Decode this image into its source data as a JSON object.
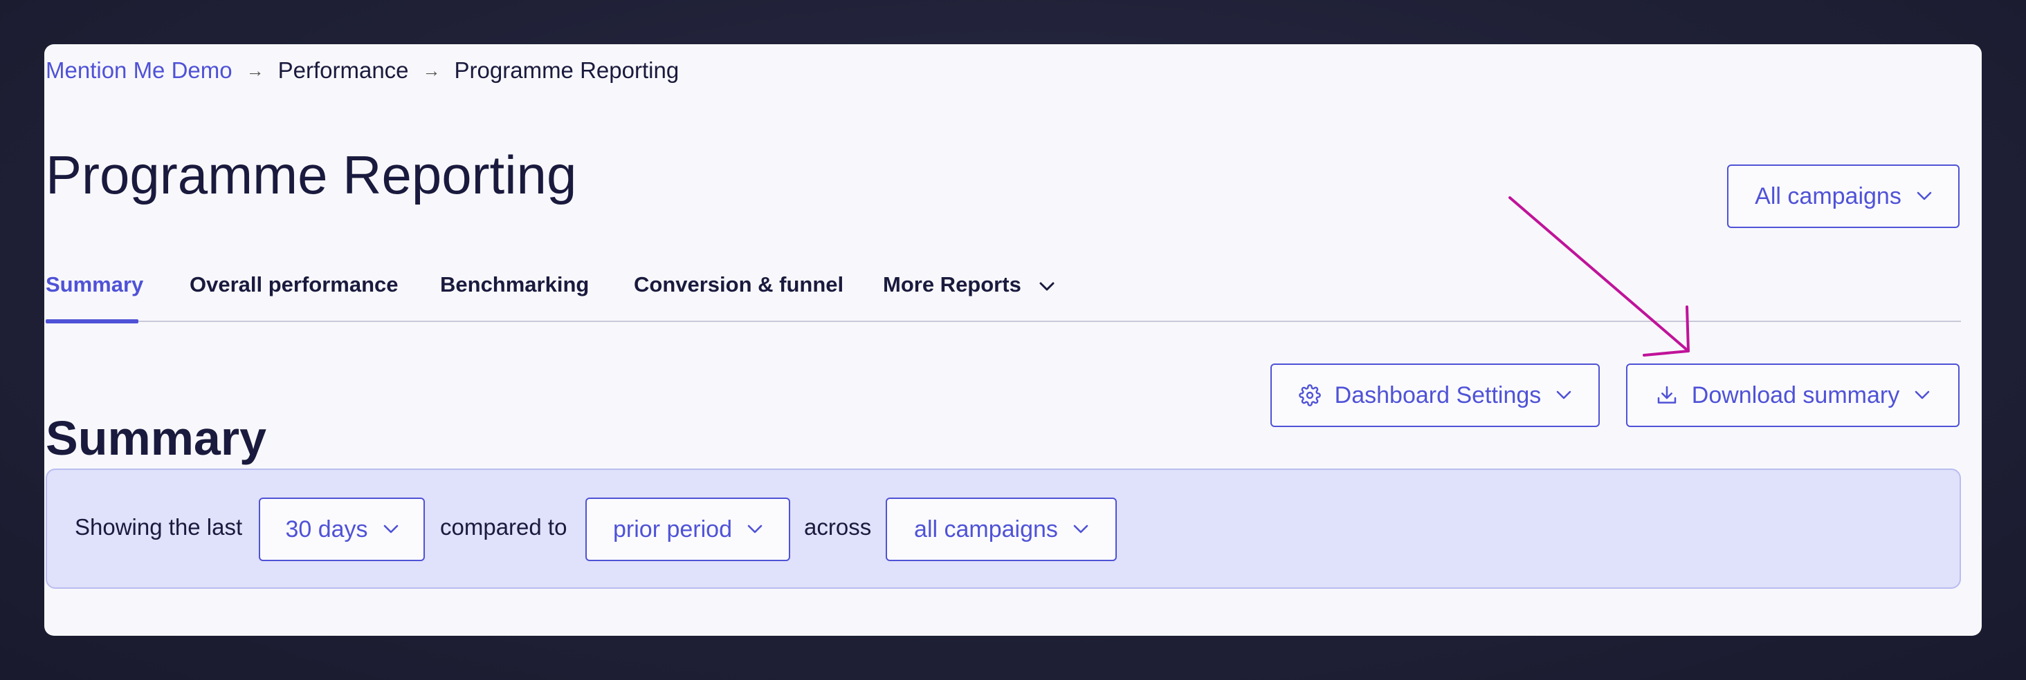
{
  "breadcrumb": {
    "items": [
      "Mention Me Demo",
      "Performance",
      "Programme Reporting"
    ],
    "separator": "→"
  },
  "page": {
    "title": "Programme Reporting",
    "campaign_selector": "All campaigns"
  },
  "tabs": [
    {
      "label": "Summary",
      "active": true
    },
    {
      "label": "Overall performance",
      "active": false
    },
    {
      "label": "Benchmarking",
      "active": false
    },
    {
      "label": "Conversion & funnel",
      "active": false
    },
    {
      "label": "More Reports",
      "active": false
    }
  ],
  "summary": {
    "title": "Summary",
    "dashboard_settings_label": "Dashboard Settings",
    "download_summary_label": "Download summary"
  },
  "filters": {
    "prefix": "Showing the last",
    "period": "30 days",
    "compared_label": "compared to",
    "comparison": "prior period",
    "across_label": "across",
    "campaigns": "all campaigns"
  },
  "colors": {
    "accent": "#4f52d6",
    "annotation_arrow": "#c0139a",
    "filter_bg": "#e0e1fa"
  },
  "icons": {
    "breadcrumb_separator": "arrow-right-icon",
    "dropdown": "chevron-down-icon",
    "settings": "gear-icon",
    "download": "download-icon"
  }
}
